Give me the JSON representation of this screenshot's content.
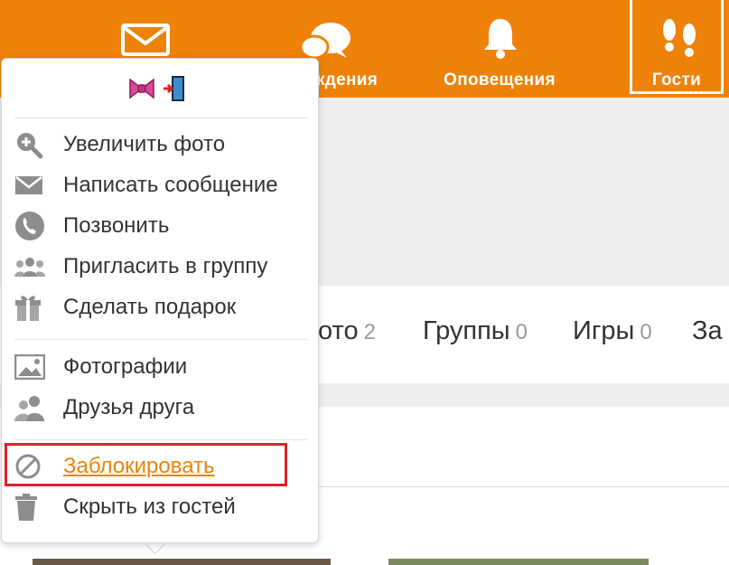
{
  "nav": {
    "items": [
      {
        "id": "mail",
        "label": ""
      },
      {
        "id": "discussions",
        "label": "ждения"
      },
      {
        "id": "notifications",
        "label": "Оповещения"
      },
      {
        "id": "guests",
        "label": "Гости"
      }
    ],
    "active": "guests",
    "accent_color": "#ee8208"
  },
  "tabs": [
    {
      "label": "ото",
      "count": "2"
    },
    {
      "label": "Группы",
      "count": "0"
    },
    {
      "label": "Игры",
      "count": "0"
    },
    {
      "label": "За",
      "count": ""
    }
  ],
  "menu": {
    "badges": [
      "bow-icon",
      "exit-door-icon"
    ],
    "items": [
      {
        "label": "Увеличить фото",
        "icon": "zoom-in-icon"
      },
      {
        "label": "Написать сообщение",
        "icon": "envelope-icon"
      },
      {
        "label": "Позвонить",
        "icon": "phone-icon"
      },
      {
        "label": "Пригласить в группу",
        "icon": "group-icon"
      },
      {
        "label": "Сделать подарок",
        "icon": "gift-icon"
      },
      {
        "label": "Фотографии",
        "icon": "photo-icon"
      },
      {
        "label": "Друзья друга",
        "icon": "friends-icon"
      },
      {
        "label": "Заблокировать",
        "icon": "block-icon",
        "highlighted": true
      },
      {
        "label": "Скрыть из гостей",
        "icon": "trash-icon"
      }
    ],
    "highlight_color": "#e0202a"
  }
}
